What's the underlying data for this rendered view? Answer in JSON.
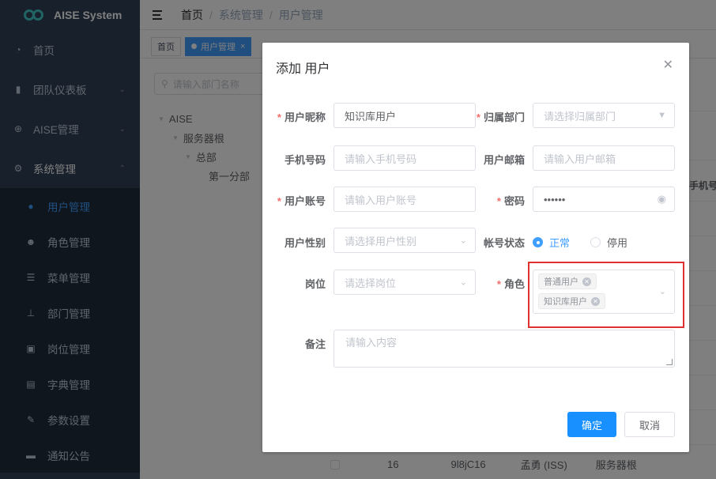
{
  "app": {
    "title": "AISE System"
  },
  "sidebar": {
    "items": [
      {
        "label": "首页",
        "icon": "dashboard-icon"
      },
      {
        "label": "团队仪表板",
        "icon": "bar-chart-icon"
      },
      {
        "label": "AISE管理",
        "icon": "plugin-icon"
      },
      {
        "label": "系统管理",
        "icon": "gear-icon"
      }
    ],
    "sub_items": [
      {
        "label": "用户管理",
        "icon": "user-icon"
      },
      {
        "label": "角色管理",
        "icon": "people-icon"
      },
      {
        "label": "菜单管理",
        "icon": "tree-table-icon"
      },
      {
        "label": "部门管理",
        "icon": "org-icon"
      },
      {
        "label": "岗位管理",
        "icon": "post-icon"
      },
      {
        "label": "字典管理",
        "icon": "dict-icon"
      },
      {
        "label": "参数设置",
        "icon": "edit-icon"
      },
      {
        "label": "通知公告",
        "icon": "message-icon"
      }
    ]
  },
  "breadcrumb": [
    "首页",
    "系统管理",
    "用户管理"
  ],
  "tags": [
    "首页",
    "用户管理"
  ],
  "dept": {
    "search_placeholder": "请输入部门名称",
    "tree": [
      "AISE",
      "服务器根",
      "总部",
      "第一分部"
    ]
  },
  "table": {
    "header_partial": "手机号码",
    "row": [
      "16",
      "9l8jC16",
      "孟勇 (ISS)",
      "服务器根"
    ]
  },
  "dialog": {
    "title": "添加 用户",
    "nickname": {
      "label": "用户昵称",
      "value": "知识库用户"
    },
    "dept": {
      "label": "归属部门",
      "placeholder": "请选择归属部门"
    },
    "phone": {
      "label": "手机号码",
      "placeholder": "请输入手机号码"
    },
    "email": {
      "label": "用户邮箱",
      "placeholder": "请输入用户邮箱"
    },
    "account": {
      "label": "用户账号",
      "placeholder": "请输入用户账号"
    },
    "password": {
      "label": "密码",
      "value": "••••••"
    },
    "gender": {
      "label": "用户性别",
      "placeholder": "请选择用户性别"
    },
    "status": {
      "label": "帐号状态",
      "options": [
        "正常",
        "停用"
      ],
      "selected": "正常"
    },
    "post": {
      "label": "岗位",
      "placeholder": "请选择岗位"
    },
    "role": {
      "label": "角色",
      "tags": [
        "普通用户",
        "知识库用户"
      ]
    },
    "remark": {
      "label": "备注",
      "placeholder": "请输入内容"
    },
    "confirm_label": "确定",
    "cancel_label": "取消"
  },
  "colors": {
    "primary": "#1890ff",
    "sidebar_bg": "#304156",
    "highlight": "#e03131"
  }
}
